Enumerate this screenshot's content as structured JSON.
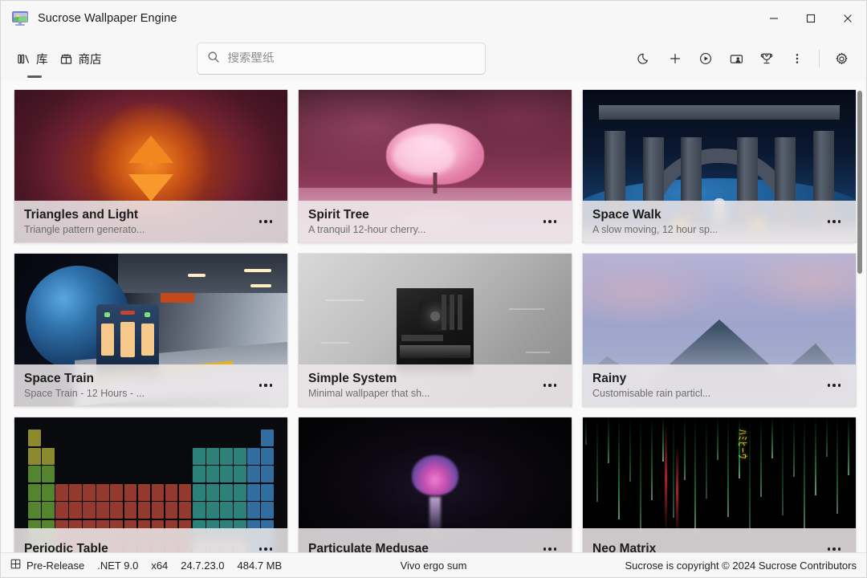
{
  "window": {
    "title": "Sucrose Wallpaper Engine",
    "app_icon": "picture-monitor-icon",
    "controls": {
      "minimize": "minimize-icon",
      "maximize": "maximize-icon",
      "close": "close-icon"
    }
  },
  "commandbar": {
    "tabs": [
      {
        "label": "库",
        "icon": "library-icon",
        "selected": true
      },
      {
        "label": "商店",
        "icon": "store-icon",
        "selected": false
      }
    ],
    "search": {
      "placeholder": "搜索壁纸",
      "value": "",
      "icon": "search-icon"
    },
    "tools": [
      {
        "name": "moon-icon",
        "tooltip": "Sleep"
      },
      {
        "name": "plus-icon",
        "tooltip": "Add"
      },
      {
        "name": "play-circle-icon",
        "tooltip": "Play"
      },
      {
        "name": "monitor-person-icon",
        "tooltip": "Screensaver"
      },
      {
        "name": "trophy-icon",
        "tooltip": "Awards"
      },
      {
        "name": "more-vertical-icon",
        "tooltip": "More"
      },
      {
        "name": "gear-icon",
        "tooltip": "Settings"
      }
    ]
  },
  "library": {
    "more_label": "more-options-icon",
    "cards": [
      {
        "title": "Triangles and Light",
        "subtitle": "Triangle pattern generato...",
        "art": "triangles"
      },
      {
        "title": "Spirit Tree",
        "subtitle": "A tranquil 12-hour cherry...",
        "art": "spirit"
      },
      {
        "title": "Space Walk",
        "subtitle": "A slow moving, 12 hour sp...",
        "art": "spacewalk"
      },
      {
        "title": "Space Train",
        "subtitle": "Space Train - 12 Hours - ...",
        "art": "train"
      },
      {
        "title": "Simple System",
        "subtitle": "Minimal wallpaper that sh...",
        "art": "system"
      },
      {
        "title": "Rainy",
        "subtitle": "Customisable rain particl...",
        "art": "rainy"
      },
      {
        "title": "Periodic Table",
        "subtitle": "",
        "art": "periodic"
      },
      {
        "title": "Particulate Medusae",
        "subtitle": "",
        "art": "medusa"
      },
      {
        "title": "Neo Matrix",
        "subtitle": "",
        "art": "matrix"
      }
    ]
  },
  "statusbar": {
    "channel_icon": "grid-icon",
    "channel": "Pre-Release",
    "runtime": ".NET 9.0",
    "arch": "x64",
    "version": "24.7.23.0",
    "memory": "484.7 MB",
    "motto": "Vivo ergo sum",
    "copyright": "Sucrose is copyright © 2024 Sucrose Contributors"
  },
  "colors": {
    "window_bg": "#f7f7f7",
    "content_bg": "#fafafa",
    "card_footer": "rgba(237,233,235,0.86)",
    "title_text": "#1c1c1c",
    "sub_text": "#6d6d6d",
    "accent_underline": "#5c5c5c"
  }
}
